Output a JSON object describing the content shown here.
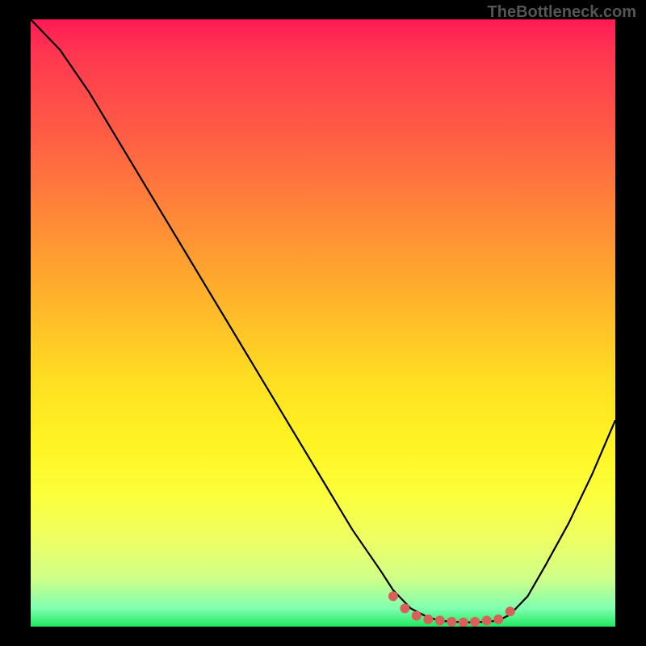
{
  "watermark": "TheBottleneck.com",
  "chart_data": {
    "type": "line",
    "title": "",
    "xlabel": "",
    "ylabel": "",
    "xlim": [
      0,
      100
    ],
    "ylim": [
      0,
      100
    ],
    "series": [
      {
        "name": "bottleneck-curve",
        "x": [
          0,
          5,
          10,
          15,
          20,
          25,
          30,
          35,
          40,
          45,
          50,
          55,
          60,
          62,
          65,
          68,
          70,
          72,
          75,
          78,
          80,
          82,
          85,
          88,
          92,
          96,
          100
        ],
        "y": [
          100,
          95,
          88,
          80,
          72,
          64,
          56,
          48,
          40,
          32,
          24,
          16,
          9,
          6,
          3,
          1.5,
          1,
          0.8,
          0.7,
          0.8,
          1,
          2,
          5,
          10,
          17,
          25,
          34
        ]
      }
    ],
    "markers": {
      "name": "optimal-range",
      "x": [
        62,
        64,
        66,
        68,
        70,
        72,
        74,
        76,
        78,
        80,
        82
      ],
      "y": [
        5,
        3,
        1.8,
        1.2,
        1,
        0.8,
        0.7,
        0.8,
        1,
        1.2,
        2.5
      ]
    },
    "background_gradient": {
      "description": "vertical gradient from red (high bottleneck) to green (optimal)",
      "stops": [
        {
          "pos": 0,
          "color": "#ff1a55"
        },
        {
          "pos": 50,
          "color": "#ffc028"
        },
        {
          "pos": 80,
          "color": "#fcff3a"
        },
        {
          "pos": 100,
          "color": "#20e860"
        }
      ]
    }
  }
}
